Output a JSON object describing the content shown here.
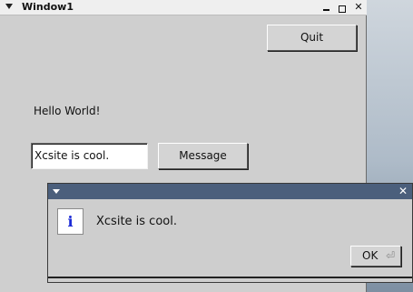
{
  "main_window": {
    "title": "Window1",
    "controls": {
      "close_glyph": "✕"
    },
    "quit_label": "Quit",
    "hello_text": "Hello World!",
    "input_value": "Xcsite is cool.",
    "message_label": "Message"
  },
  "dialog": {
    "close_glyph": "✕",
    "icon_glyph": "i",
    "message": "Xcsite is cool.",
    "ok_label": "OK",
    "return_glyph": "⏎"
  },
  "colors": {
    "dialog_titlebar": "#4b5f7c",
    "info_icon": "#1c2bd6",
    "window_bg": "#cfcfcf"
  },
  "icons": {
    "window_menu": "triangle-down-icon",
    "minimize": "minimize-icon",
    "maximize": "maximize-icon",
    "close": "close-icon",
    "info": "info-icon",
    "return": "return-icon"
  }
}
